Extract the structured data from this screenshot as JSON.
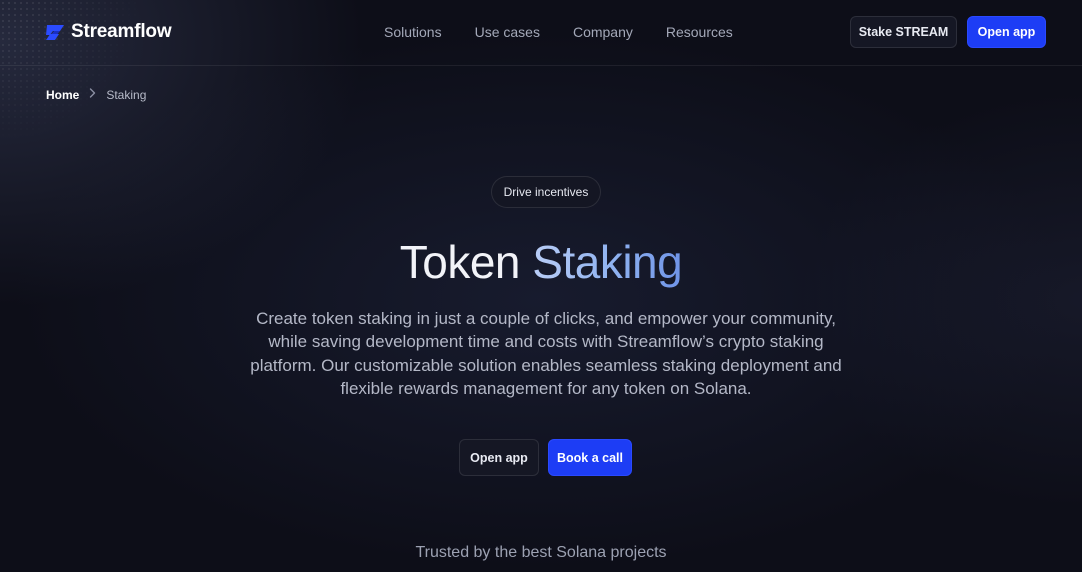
{
  "brand": {
    "name": "Streamflow",
    "logo_icon": "streamflow-s-icon",
    "logo_color": "#2b4bff"
  },
  "nav": {
    "items": [
      {
        "label": "Solutions"
      },
      {
        "label": "Use cases"
      },
      {
        "label": "Company"
      },
      {
        "label": "Resources"
      }
    ],
    "stake_label": "Stake STREAM",
    "open_app_label": "Open app"
  },
  "breadcrumb": {
    "home": "Home",
    "separator_icon": "chevron-right-icon",
    "current": "Staking"
  },
  "hero": {
    "badge": "Drive incentives",
    "title_part1": "Token",
    "title_part2": "Staking",
    "description": "Create token staking in just a couple of clicks, and empower your community, while saving development time and costs with Streamflow’s crypto staking platform. Our customizable solution enables seamless staking deployment and flexible rewards management for any token on Solana.",
    "open_app_label": "Open app",
    "book_call_label": "Book a call"
  },
  "trusted": {
    "text": "Trusted by the best Solana projects"
  },
  "colors": {
    "accent": "#1d3df5",
    "background": "#0d0e18",
    "title_gradient_start": "#b9cdf6",
    "title_gradient_end": "#6f94e8"
  }
}
